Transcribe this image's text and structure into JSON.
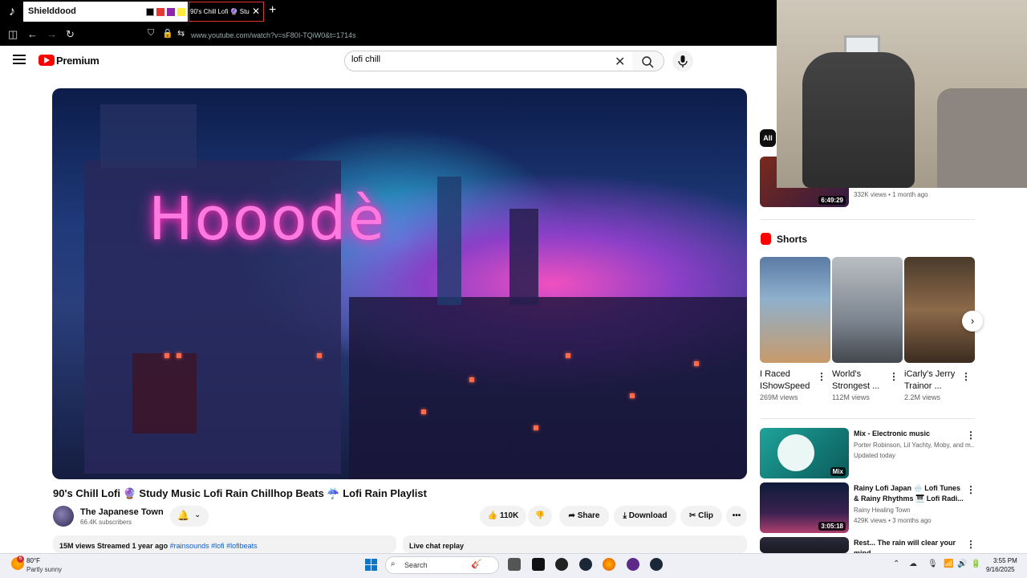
{
  "browser": {
    "tab_inactive_label": "Shielddood",
    "tab_active_label": "90's Chill Lofi 🔮 Stu",
    "url": "www.youtube.com/watch?v=sF80I-TQiW0&t=1714s",
    "swatches": [
      "#000000",
      "#e53935",
      "#8e24aa",
      "#ffeb3b"
    ]
  },
  "header": {
    "brand": "Premium",
    "search_value": "lofi chill"
  },
  "player": {
    "sign_text": "Hooodè"
  },
  "video": {
    "title": "90's Chill Lofi 🔮 Study Music Lofi Rain Chillhop Beats ☔ Lofi Rain Playlist",
    "channel_name": "The Japanese Town",
    "subscribers": "66.4K subscribers",
    "likes": "110K",
    "share_label": "Share",
    "download_label": "Download",
    "clip_label": "Clip",
    "desc_stats": "15M views  Streamed 1 year ago",
    "desc_tags": "#rainsounds #lofi #lofibeats",
    "chat_label": "Live chat replay"
  },
  "sidebar": {
    "chip_all": "All",
    "top_item": {
      "duration": "6:49:29",
      "meta": "332K views • 1 month ago"
    },
    "shorts_heading": "Shorts",
    "shorts": [
      {
        "title": "I Raced IShowSpeed",
        "views": "269M views"
      },
      {
        "title": "World's Strongest ...",
        "views": "112M views"
      },
      {
        "title": "iCarly's Jerry Trainor ...",
        "views": "2.2M views"
      }
    ],
    "recs": [
      {
        "title": "Mix - Electronic music",
        "meta1": "Porter Robinson, Lil Yachty, Moby, and m...",
        "meta2": "Updated today",
        "badge": "Mix"
      },
      {
        "title": "Rainy Lofi Japan 🌧️ Lofi Tunes & Rainy Rhythms 🎹 Lofi Radi...",
        "meta1": "Rainy Healing Town",
        "meta2": "429K views • 3 months ago",
        "duration": "3:05:18"
      },
      {
        "title": "Rest... The rain will clear your mind",
        "meta1": "",
        "meta2": ""
      }
    ]
  },
  "taskbar": {
    "weather_badge": "6",
    "temp": "80°F",
    "condition": "Partly sunny",
    "search_label": "Search",
    "time": "3:55 PM",
    "date": "9/16/2025"
  }
}
